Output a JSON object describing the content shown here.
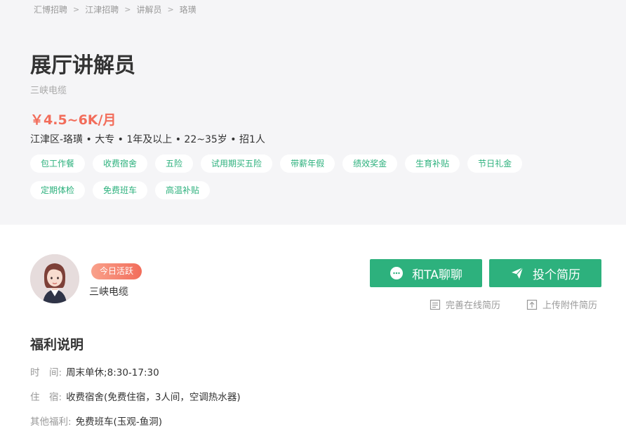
{
  "breadcrumb": [
    "汇博招聘",
    "江津招聘",
    "讲解员",
    "珞璜"
  ],
  "job": {
    "title": "展厅讲解员",
    "company": "三峡电缆",
    "salary": "￥4.5~6K/月",
    "info": "江津区-珞璜 • 大专 • 1年及以上 • 22~35岁 • 招1人"
  },
  "tags": [
    "包工作餐",
    "收费宿舍",
    "五险",
    "试用期买五险",
    "带薪年假",
    "绩效奖金",
    "生育补贴",
    "节日礼金",
    "定期体检",
    "免费班车",
    "高温补贴"
  ],
  "recruiter": {
    "badge": "今日活跃",
    "company": "三峡电缆"
  },
  "actions": {
    "chat": "和TA聊聊",
    "apply": "投个简历",
    "improve": "完善在线简历",
    "upload": "上传附件简历"
  },
  "benefits": {
    "title": "福利说明",
    "time_label": "时　间:",
    "time_value": "周末单休;8:30-17:30",
    "lodging_label": "住　宿:",
    "lodging_value": "收费宿舍(免费住宿，3人间，空调热水器)",
    "other_label": "其他福利:",
    "other_value": "免费班车(玉观-鱼洞)"
  },
  "colors": {
    "accent": "#2db17d",
    "salary": "#f26d5b",
    "badge": "#f26d5b"
  }
}
